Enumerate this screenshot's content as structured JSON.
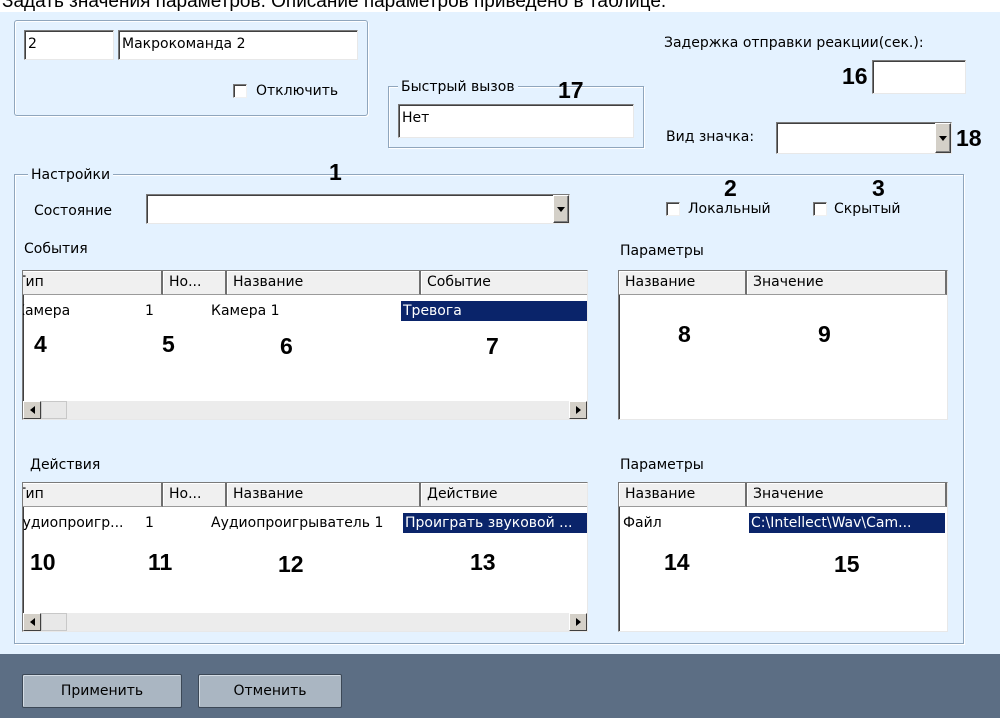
{
  "caption": "Задать значения параметров. Описание параметров приведено в таблице.",
  "macro": {
    "id": "2",
    "name": "Макрокоманда 2",
    "disable_label": "Отключить"
  },
  "quick_call": {
    "legend": "Быстрый вызов",
    "value": "Нет"
  },
  "delay": {
    "label": "Задержка отправки реакции(сек.):",
    "value": ""
  },
  "icon_type": {
    "label": "Вид значка:",
    "value": ""
  },
  "settings": {
    "legend": "Настройки",
    "state_label": "Состояние",
    "state_value": "",
    "local_label": "Локальный",
    "hidden_label": "Скрытый"
  },
  "events": {
    "title": "События",
    "columns": [
      "Тип",
      "Но...",
      "Название",
      "Событие"
    ],
    "rows": [
      [
        "Камера",
        "1",
        "Камера 1",
        "Тревога"
      ]
    ]
  },
  "event_params": {
    "title": "Параметры",
    "columns": [
      "Название",
      "Значение"
    ],
    "rows": []
  },
  "actions": {
    "title": "Действия",
    "columns": [
      "Тип",
      "Но...",
      "Название",
      "Действие"
    ],
    "rows": [
      [
        "Аудиопроигр...",
        "1",
        "Аудиопроигрыватель 1",
        "Проиграть звуковой ..."
      ]
    ]
  },
  "action_params": {
    "title": "Параметры",
    "columns": [
      "Название",
      "Значение"
    ],
    "rows": [
      [
        "Файл",
        "C:\\Intellect\\Wav\\Cam..."
      ]
    ]
  },
  "annotations": [
    "1",
    "2",
    "3",
    "4",
    "5",
    "6",
    "7",
    "8",
    "9",
    "10",
    "11",
    "12",
    "13",
    "14",
    "15",
    "16",
    "17",
    "18"
  ],
  "buttons": {
    "apply": "Применить",
    "cancel": "Отменить"
  },
  "colors": {
    "background": "#e4f2ff",
    "selection": "#0a246a",
    "bottom_bar": "#5c6e84"
  }
}
